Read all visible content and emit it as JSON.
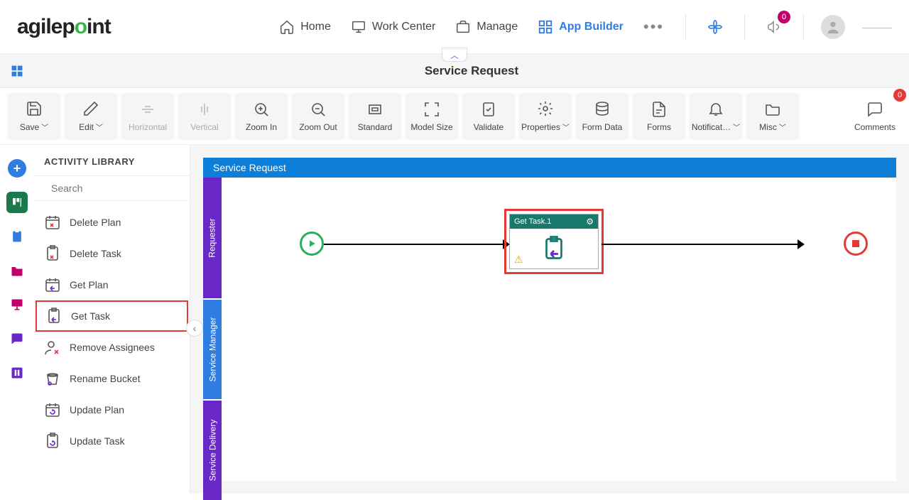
{
  "header": {
    "logo_text": "agilepoint",
    "nav": {
      "home": "Home",
      "work_center": "Work Center",
      "manage": "Manage",
      "app_builder": "App Builder"
    },
    "notification_badge": "0",
    "comments_badge": "0",
    "username": "———"
  },
  "titlebar": {
    "title": "Service Request"
  },
  "toolbar": {
    "save": "Save",
    "edit": "Edit",
    "horizontal": "Horizontal",
    "vertical": "Vertical",
    "zoom_in": "Zoom In",
    "zoom_out": "Zoom Out",
    "standard": "Standard",
    "model_size": "Model Size",
    "validate": "Validate",
    "properties": "Properties",
    "form_data": "Form Data",
    "forms": "Forms",
    "notifications": "Notificat…",
    "misc": "Misc",
    "comments": "Comments"
  },
  "panel": {
    "title": "ACTIVITY LIBRARY",
    "search_placeholder": "Search",
    "items": [
      {
        "label": "Delete Plan"
      },
      {
        "label": "Delete Task"
      },
      {
        "label": "Get Plan"
      },
      {
        "label": "Get Task",
        "selected": true
      },
      {
        "label": "Remove Assignees"
      },
      {
        "label": "Rename Bucket"
      },
      {
        "label": "Update Plan"
      },
      {
        "label": "Update Task"
      }
    ]
  },
  "canvas": {
    "header": "Service Request",
    "lanes": [
      "Requester",
      "Service Manager",
      "Service Delivery"
    ],
    "task_node": {
      "title": "Get Task.1"
    }
  }
}
